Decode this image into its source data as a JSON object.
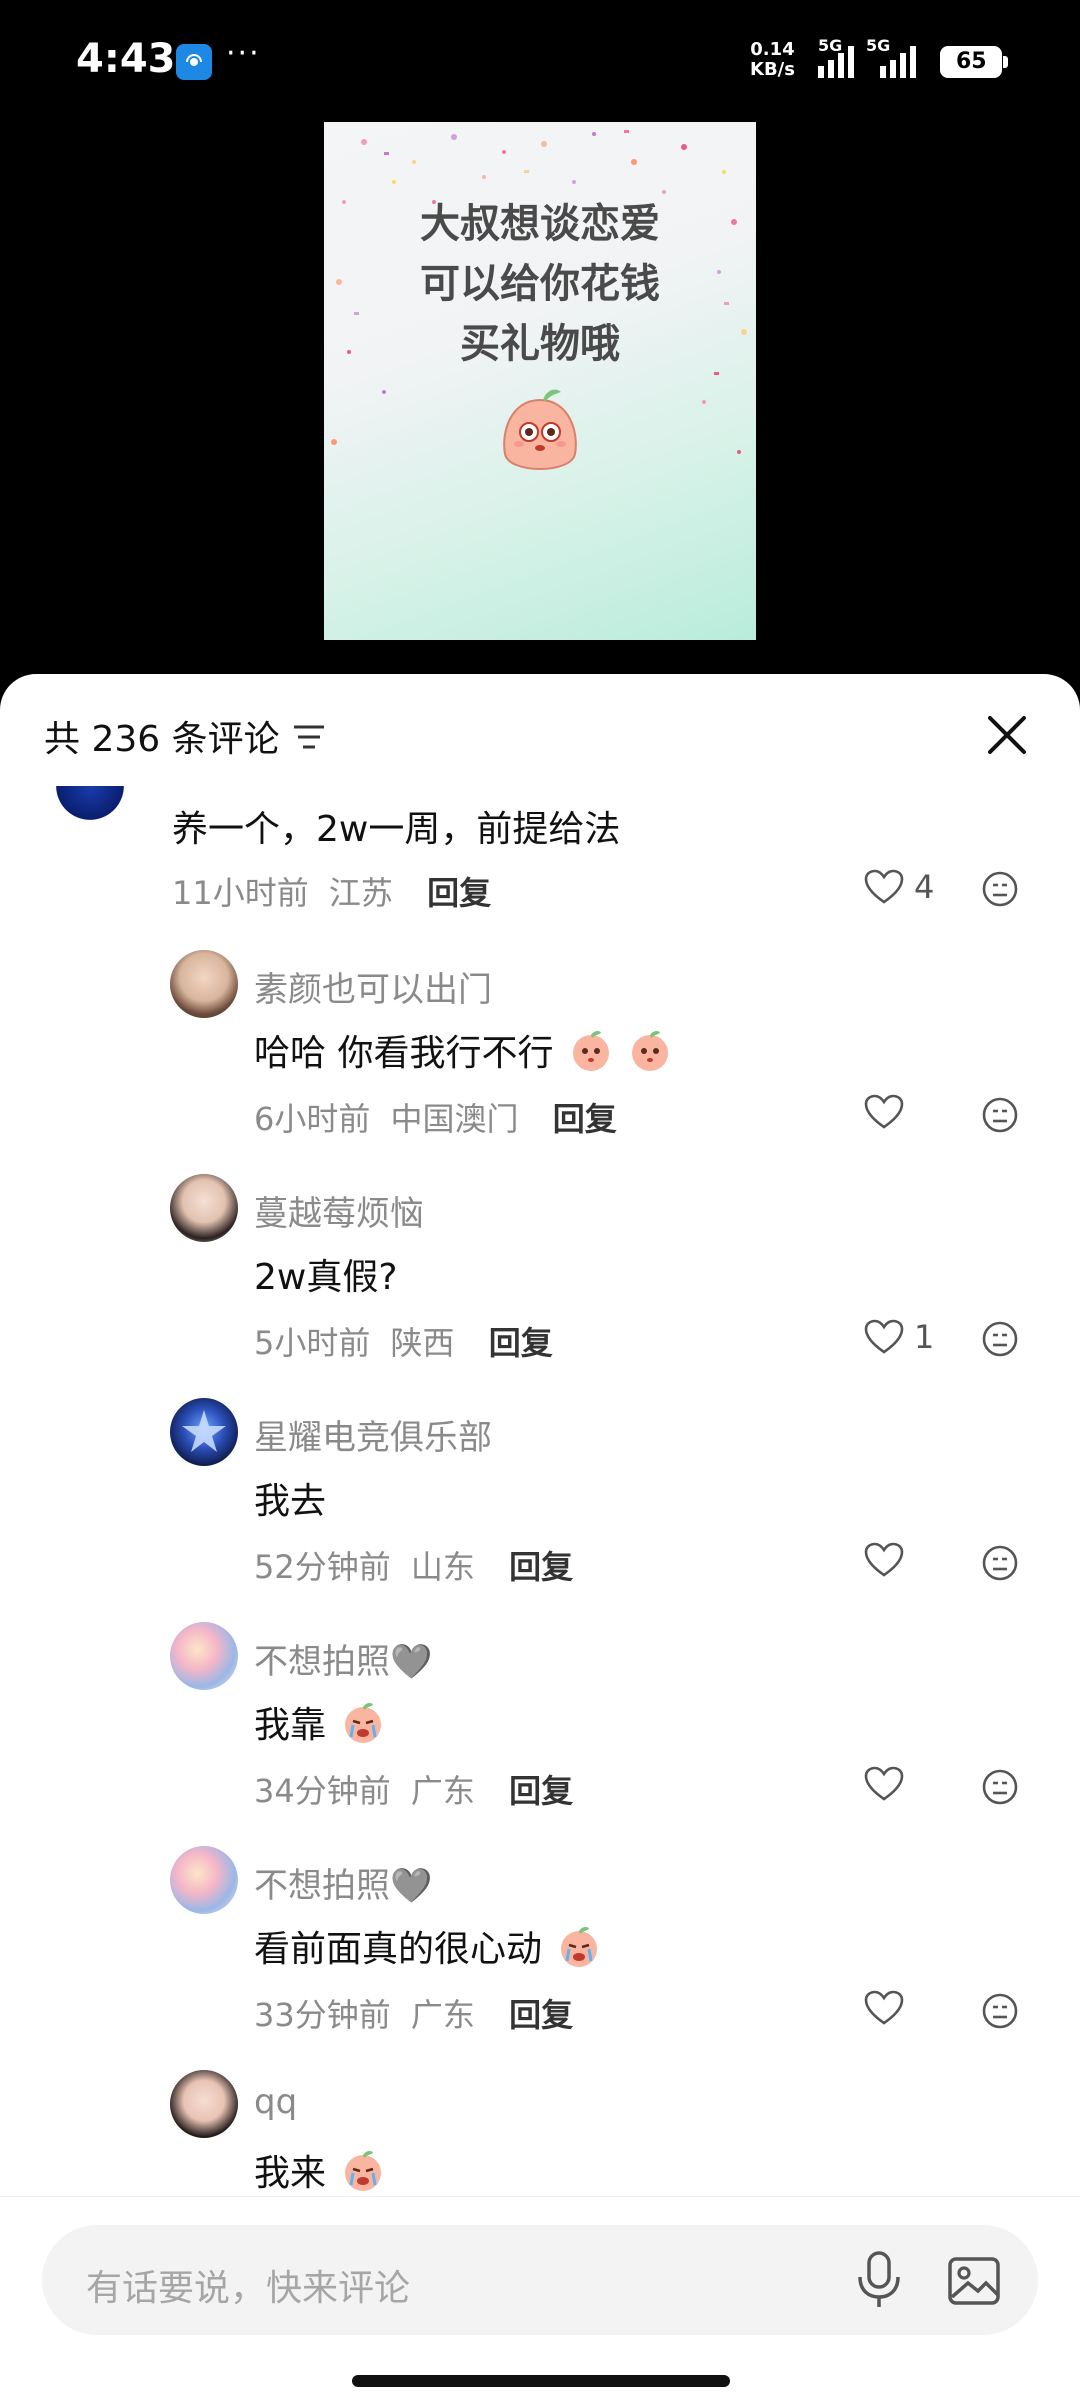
{
  "status_bar": {
    "time": "4:43",
    "dots": "···",
    "net_speed_value": "0.14",
    "net_speed_unit": "KB/s",
    "signal1_label": "5G",
    "signal2_label": "5G",
    "battery": "65"
  },
  "video": {
    "line1": "大叔想谈恋爱",
    "line2": "可以给你花钱",
    "line3": "买礼物哦"
  },
  "header": {
    "comment_count": "共 236 条评论"
  },
  "top_comment": {
    "text": "养一个，2w一周，前提给法",
    "time": "11小时前",
    "location": "江苏",
    "reply": "回复",
    "likes": "4"
  },
  "replies": [
    {
      "name": "素颜也可以出门",
      "text": "哈哈  你看我行不行",
      "time": "6小时前",
      "location": "中国澳门",
      "reply": "回复",
      "likes": ""
    },
    {
      "name": "蔓越莓烦恼",
      "text": "2w真假?",
      "time": "5小时前",
      "location": "陕西",
      "reply": "回复",
      "likes": "1"
    },
    {
      "name": "星耀电竞俱乐部",
      "text": "我去",
      "time": "52分钟前",
      "location": "山东",
      "reply": "回复",
      "likes": ""
    },
    {
      "name": "不想拍照🩶",
      "text": "我靠",
      "time": "34分钟前",
      "location": "广东",
      "reply": "回复",
      "likes": ""
    },
    {
      "name": "不想拍照🩶",
      "text": "看前面真的很心动",
      "time": "33分钟前",
      "location": "广东",
      "reply": "回复",
      "likes": ""
    },
    {
      "name": "qq",
      "text": "我来",
      "time": "",
      "location": "",
      "reply": "",
      "likes": ""
    }
  ],
  "input": {
    "placeholder": "有话要说，快来评论"
  },
  "colors": {
    "accent_text": "#111111",
    "meta_text": "#8a8a8a",
    "sheet_bg": "#ffffff",
    "input_bg": "#f3f3f3"
  },
  "icons": [
    "app-icon",
    "filter-icon",
    "close-icon",
    "heart-icon",
    "dislike-icon",
    "mic-icon",
    "image-icon",
    "peach-emoji-icon",
    "crying-emoji-icon"
  ]
}
